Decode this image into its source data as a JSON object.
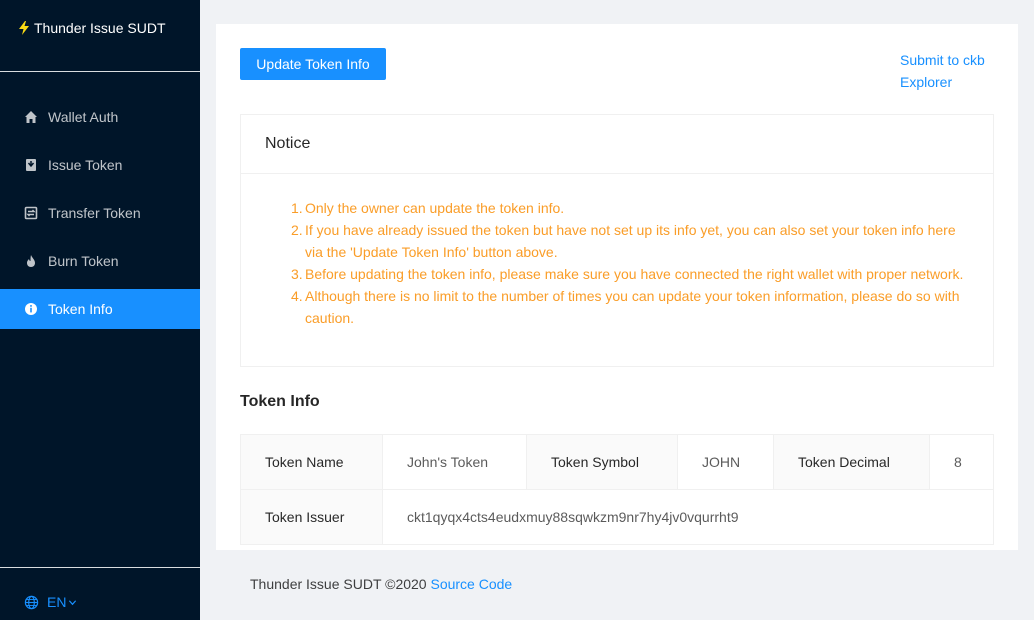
{
  "app": {
    "title": "Thunder Issue SUDT"
  },
  "sidebar": {
    "items": [
      {
        "label": "Wallet Auth",
        "icon": "home-icon"
      },
      {
        "label": "Issue Token",
        "icon": "issue-icon"
      },
      {
        "label": "Transfer Token",
        "icon": "transfer-icon"
      },
      {
        "label": "Burn Token",
        "icon": "fire-icon"
      },
      {
        "label": "Token Info",
        "icon": "info-icon",
        "active": true
      }
    ],
    "language": "EN"
  },
  "toolbar": {
    "update_label": "Update Token Info",
    "submit_link": "Submit to ckb Explorer"
  },
  "notice": {
    "title": "Notice",
    "items": [
      {
        "num": "1.",
        "text": "Only the owner can update the token info."
      },
      {
        "num": "2.",
        "text": "If you have already issued the token but have not set up its info yet, you can also set your token info here via the 'Update Token Info' button above."
      },
      {
        "num": "3.",
        "text": "Before updating the token info, please make sure you have connected the right wallet with proper network."
      },
      {
        "num": "4.",
        "text": "Although there is no limit to the number of times you can update your token information, please do so with caution."
      }
    ]
  },
  "token_info": {
    "title": "Token Info",
    "name_label": "Token Name",
    "name_value": "John's Token",
    "symbol_label": "Token Symbol",
    "symbol_value": "JOHN",
    "decimal_label": "Token Decimal",
    "decimal_value": "8",
    "issuer_label": "Token Issuer",
    "issuer_value": "ckt1qyqx4cts4eudxmuy88sqwkzm9nr7hy4jv0vqurrht9"
  },
  "footer": {
    "text": "Thunder Issue SUDT ©2020",
    "link": "Source Code"
  },
  "colors": {
    "sidebar_bg": "#001529",
    "accent": "#1890ff",
    "notice_text": "#fa9d28"
  }
}
